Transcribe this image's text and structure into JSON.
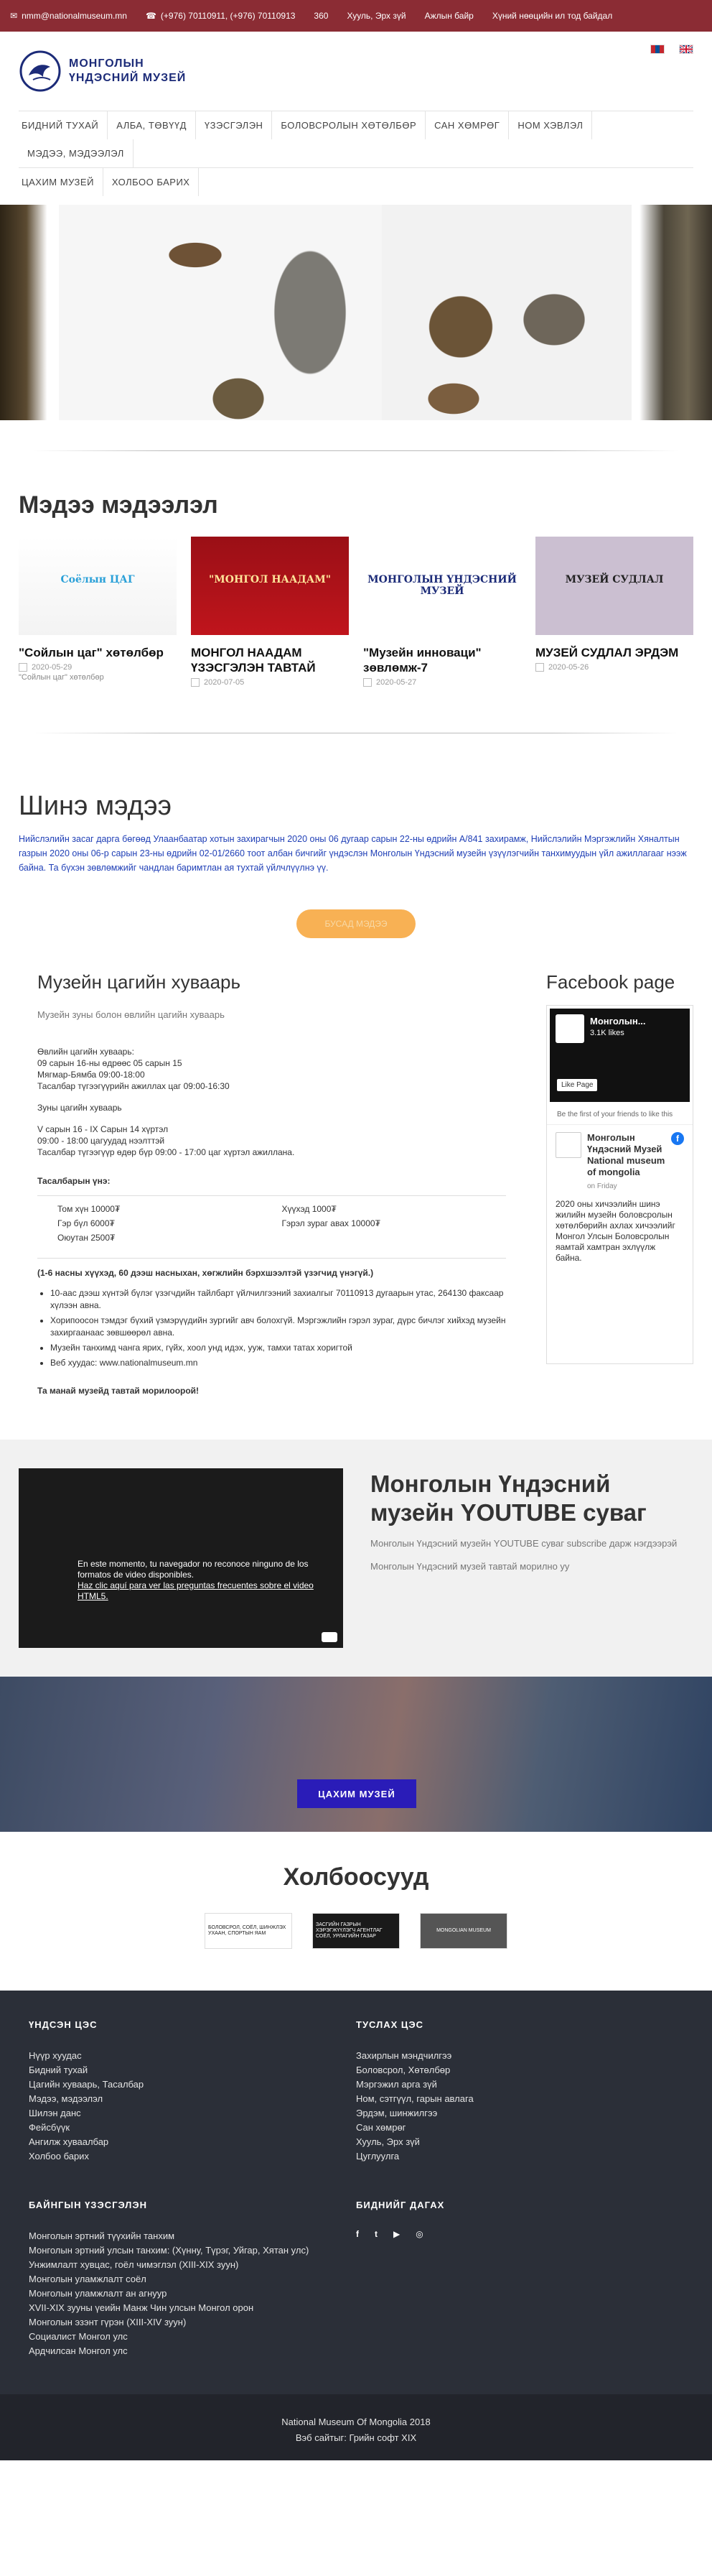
{
  "topbar": {
    "email": "nmm@nationalmuseum.mn",
    "phones": "(+976) 70110911, (+976) 70110913",
    "tour": "360",
    "address": "Хууль, Эрх зүй",
    "jobs": "Ажлын байр",
    "complaint": "Хүний нөөцийн ил тод байдал"
  },
  "logo": {
    "line1": "МОНГОЛЫН",
    "line2": "ҮНДЭСНИЙ МУЗЕЙ"
  },
  "flags": [
    {
      "name": "mongolia-flag",
      "colors": [
        "#c4272f",
        "#015197",
        "#c4272f"
      ]
    },
    {
      "name": "uk-flag",
      "colors": [
        "#012169",
        "#c8102e",
        "#ffffff"
      ]
    }
  ],
  "nav": {
    "row1": [
      "БИДНИЙ ТУХАЙ",
      "АЛБА, ТӨВҮҮД",
      "ҮЗЭСГЭЛЭН",
      "БОЛОВСРОЛЫН ХӨТӨЛБӨР",
      "САН ХӨМРӨГ",
      "НОМ ХЭВЛЭЛ",
      "МЭДЭЭ, МЭДЭЭЛЭЛ"
    ],
    "row2": [
      "ЦАХИМ МУЗЕЙ",
      "ХОЛБОО БАРИХ"
    ]
  },
  "news": {
    "title": "Мэдээ мэдээлэл",
    "cards": [
      {
        "title": "\"Сойлын цаг\" хөтөлбөр",
        "date": "2020-05-29",
        "excerpt": "\"Сойлын цаг\" хөтөлбөр",
        "thumb_text": "Соёлын ЦАГ"
      },
      {
        "title": "МОНГОЛ НААДАМ ҮЗЭСГЭЛЭН ТАВТАЙ",
        "date": "2020-07-05",
        "excerpt": "",
        "thumb_text": "\"МОНГОЛ НААДАМ\""
      },
      {
        "title": "\"Музейн инноваци\" зөвлөмж-7",
        "date": "2020-05-27",
        "excerpt": "",
        "thumb_text": "МОНГОЛЫН ҮНДЭСНИЙ МУЗЕЙ"
      },
      {
        "title": "МУЗЕЙ СУДЛАЛ ЭРДЭМ",
        "date": "2020-05-26",
        "excerpt": "",
        "thumb_text": "МУЗЕЙ СУДЛАЛ"
      }
    ]
  },
  "new_news": {
    "title": "Шинэ мэдээ",
    "text": "Нийслэлийн засаг дарга бөгөөд Улаанбаатар хотын захирагчын 2020 оны 06 дугаар сарын 22-ны өдрийн А/841 захирамж, Нийслэлийн Мэргэжлийн Хяналтын газрын 2020 оны 06-р сарын 23-ны өдрийн 02-01/2660 тоот албан бичгийг үндэслэн Монголын Үндэсний музейн үзүүлэгчийн танхимуудын үйл ажиллагааг нээж байна. Та бүхэн зөвлөмжийг чандлан баримтлан ая тухтай үйлчлүүлнэ үү.",
    "more": "БУСАД МЭДЭЭ"
  },
  "schedule": {
    "title": "Музейн цагийн хуваарь",
    "subtitle": "Музейн зуны болон өвлийн цагийн хуваарь",
    "winter": [
      "Өвлийн цагийн хуваарь:",
      "09 сарын 16-ны өдрөөс 05 сарын 15",
      "Мягмар-Бямба 09:00-18:00",
      "Тасалбар түгээгүүрийн ажиллах цаг 09:00-16:30"
    ],
    "summer_h": "Зуны цагийн хуваарь",
    "summer": [
      "V сарын 16 - IX Сарын 14 хүртэл",
      "09:00 - 18:00 цагуудад нээлттэй",
      "Тасалбар түгээгүүр өдөр бүр 09:00 - 17:00 цаг хүртэл ажиллана."
    ],
    "ticket_h": "Тасалбарын үнэ:",
    "tickets": [
      "Том хүн 10000₮",
      "Хүүхэд 1000₮",
      "Гэр бүл 6000₮",
      "Гэрэл зураг авах 10000₮",
      "Оюутан 2500₮",
      ""
    ],
    "note": "(1-6 насны хүүхэд, 60 дээш насныхан, хөгжлийн бэрхшээлтэй үзэгчид үнэгүй.)",
    "bullets": [
      "10-аас дээш хүнтэй бүлэг үзэгчдийн тайлбарт үйлчилгээний захиалгыг 70110913 дугаарын утас, 264130 факсаар хүлээн авна.",
      "Хорипоосон тэмдэг бүхий үзмэрүүдийн зургийг авч болохгүй. Мэргэжлийн гэрэл зураг, дүрс бичлэг хийхэд музейн захиргаанаас зөвшөөрөл авна.",
      "Музейн танхимд чанга ярих, гүйх, хоол унд идэх, ууж, тамхи татах хоригтой",
      "Веб хуудас: www.nationalmuseum.mn"
    ],
    "welcome": "Та манай музейд тавтай морилоорой!"
  },
  "facebook": {
    "title": "Facebook page",
    "page_name": "Монголын...",
    "likes": "3.1K likes",
    "like_btn": "Like Page",
    "first_friend": "Be the first of your friends to like this",
    "post_name": "Монголын Үндэсний Музей National museum of mongolia",
    "post_time": "on Friday",
    "post_text": "2020 оны хичээлийн шинэ жилийн музейн боловсролын хөтөлбөрийн ахлах хичээлийг Монгол Улсын Боловсролын яамтай хамтран эхлүүлж байна."
  },
  "youtube": {
    "title": "Монголын Үндэсний музейн YOUTUBE суваг",
    "desc": "Монголын Үндэсний музейн YOUTUBE суваг subscribe дарж нэгдээрэй",
    "welcome": "Монголын Үндэсний музей тавтай морилно уу",
    "msg1": "En este momento, tu navegador no reconoce ninguno de los formatos de video disponibles.",
    "msg2": "Haz clic aquí para ver las preguntas frecuentes sobre el video HTML5."
  },
  "digital": {
    "button": "ЦАХИМ МУЗЕЙ"
  },
  "partners": {
    "title": "Холбоосууд",
    "logos": [
      {
        "name": "ministry-culture-logo",
        "text": "БОЛОВСРОЛ, СОЁЛ, ШИНЖЛЭХ УХААН, СПОРТЫН ЯАМ",
        "bg": "#ffffff",
        "fg": "#222222"
      },
      {
        "name": "govt-agency-logo",
        "text": "ЗАСГИЙН ГАЗРЫН ХЭРЭГЖҮҮЛЭГЧ АГЕНТЛАГ СОЁЛ, УРЛАГИЙН ГАЗАР",
        "bg": "#1a1a1a",
        "fg": "#ffffff"
      },
      {
        "name": "museum-association-logo",
        "text": "MONGOLIAN MUSEUM",
        "bg": "#555555",
        "fg": "#ffffff"
      }
    ]
  },
  "footer": {
    "main_h": "ҮНДСЭН ЦЭС",
    "main": [
      "Нүүр хуудас",
      "Бидний тухай",
      "Цагийн хуваарь, Тасалбар",
      "Мэдээ, мэдээлэл",
      "Шилэн данс",
      "Фейсбүүк",
      "Ангилж хуваалбар",
      "Холбоо барих"
    ],
    "aux_h": "ТУСЛАХ ЦЭС",
    "aux": [
      "Захирлын мэндчилгээ",
      "Боловсрол, Хөтөлбөр",
      "Мэргэжил арга зүй",
      "Ном, сэтгүүл, гарын авлага",
      "Эрдэм, шинжилгээ",
      "Сан хөмрөг",
      "Хууль, Эрх зүй",
      "Цуглуулга"
    ],
    "exh_h": "БАЙНГЫН ҮЗЭСГЭЛЭН",
    "exh": [
      "Монголын эртний түүхийн танхим",
      "Монголын эртний улсын танхим: (Хүнну, Түрэг, Уйгар, Хятан улс)",
      "Унжимлалт хувцас, гоёл чимэглэл (XIII-XIX зуун)",
      "Монголын уламжлалт соёл",
      "Монголын уламжлалт ан агнуур",
      "XVII-XIX зууны үеийн Манж Чин улсын Монгол орон",
      "Монголын эзэнт гүрэн (XIII-XIV зуун)",
      "Социалист Монгол улс",
      "Ардчилсан Монгол улс"
    ],
    "follow_h": "БИДНИЙГ ДАГАХ",
    "social": [
      "f",
      "t",
      "▶",
      "◎"
    ]
  },
  "bottom": {
    "line1": "National Museum Of Mongolia 2018",
    "line2": "Вэб сайтыг: Грийн софт XIX"
  }
}
